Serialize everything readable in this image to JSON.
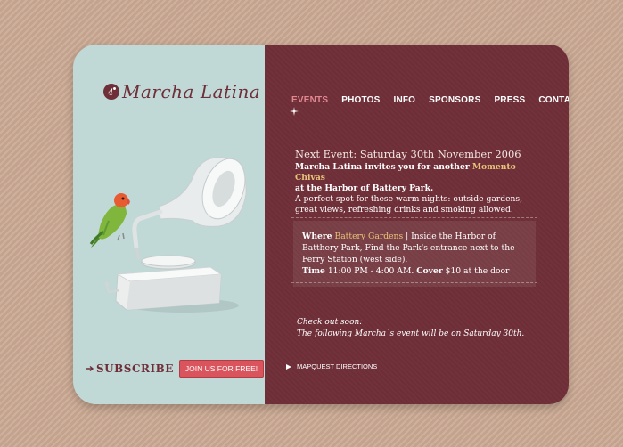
{
  "brand": {
    "name": "Marcha Latina",
    "mark_glyph": "ᶠ"
  },
  "nav": {
    "items": [
      {
        "label": "EVENTS",
        "active": true
      },
      {
        "label": "PHOTOS",
        "active": false
      },
      {
        "label": "INFO",
        "active": false
      },
      {
        "label": "SPONSORS",
        "active": false
      },
      {
        "label": "PRESS",
        "active": false
      },
      {
        "label": "CONTACT",
        "active": false
      }
    ]
  },
  "event": {
    "title": "Next Event: Saturday 30th November 2006",
    "invite_prefix": "Marcha Latina invites you for another",
    "invite_highlight": "Momento Chivas",
    "invite_suffix": "at the Harbor of Battery Park.",
    "description": "A perfect spot for these warm nights: outside gardens, great views, refreshing drinks and smoking allowed."
  },
  "details": {
    "where_label": "Where",
    "where_value": "Battery Gardens",
    "where_text": "| Inside the Harbor of Batthery Park, Find the Park's entrance next to the Ferry Station (west side).",
    "time_label": "Time",
    "time_value": "11:00 PM - 4:00 AM.",
    "cover_label": "Cover",
    "cover_value": "$10 at the door"
  },
  "soon": {
    "line1": "Check out soon:",
    "line2": "The following Marcha´s event will be on Saturday 30th."
  },
  "links": {
    "mapquest": "MAPQUEST DIRECTIONS"
  },
  "subscribe": {
    "label": "SUBSCRIBE",
    "button": "JOIN US FOR FREE!"
  },
  "colors": {
    "maroon": "#6f2f38",
    "teal": "#c0d8d6",
    "accent_pink": "#d9545c",
    "highlight": "#e7c47a"
  },
  "icons": [
    "record-logo-icon",
    "star-icon",
    "arrow-icon",
    "triangle-bullet-icon",
    "parrot-gramophone-illustration"
  ]
}
